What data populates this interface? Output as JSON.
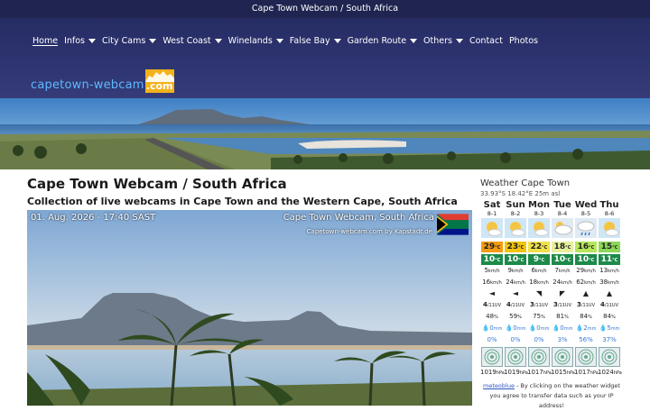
{
  "header": {
    "title": "Cape Town Webcam / South Africa"
  },
  "nav": {
    "items": [
      {
        "label": "Home",
        "dropdown": false
      },
      {
        "label": "Infos",
        "dropdown": true
      },
      {
        "label": "City Cams",
        "dropdown": true
      },
      {
        "label": "West Coast",
        "dropdown": true
      },
      {
        "label": "Winelands",
        "dropdown": true
      },
      {
        "label": "False Bay",
        "dropdown": true
      },
      {
        "label": "Garden Route",
        "dropdown": true
      },
      {
        "label": "Others",
        "dropdown": true
      },
      {
        "label": "Contact",
        "dropdown": false
      },
      {
        "label": "Photos",
        "dropdown": false
      }
    ]
  },
  "logo": {
    "text": "capetown-webcam",
    "suffix": ".com"
  },
  "main": {
    "title": "Cape Town Webcam / South Africa",
    "subtitle": "Collection of live webcams in Cape Town and the Western Cape, South Africa"
  },
  "webcam": {
    "datetime": "01. Aug. 2026 - 17:40 SAST",
    "title": "Cape Town Webcam, South Africa",
    "credit": "Capetown-webcam.com by Kapstadt.de"
  },
  "weather": {
    "title": "Weather Cape Town",
    "coords": "33.93°S 18.42°E 25m asl",
    "days": [
      {
        "name": "Sat",
        "date": "8-1",
        "icon": "sun-cloud-icon",
        "tmax": "29",
        "tmax_color": "#f39c12",
        "tmin": "10",
        "wind": "5",
        "gust": "16",
        "dir": "◄",
        "uv": "4",
        "humidity": "48",
        "rain": "0",
        "sun": "1019"
      },
      {
        "name": "Sun",
        "date": "8-2",
        "icon": "sun-cloud-icon",
        "tmax": "23",
        "tmax_color": "#f1c40f",
        "tmin": "10",
        "wind": "9",
        "gust": "24",
        "dir": "◄",
        "uv": "4",
        "humidity": "59",
        "rain": "0",
        "sun": "1019"
      },
      {
        "name": "Mon",
        "date": "8-3",
        "icon": "sun-cloud-icon",
        "tmax": "22",
        "tmax_color": "#f1e04a",
        "tmin": "9",
        "wind": "6",
        "gust": "18",
        "dir": "◥",
        "uv": "3",
        "humidity": "75",
        "rain": "0",
        "sun": "1017"
      },
      {
        "name": "Tue",
        "date": "8-4",
        "icon": "cloud-icon",
        "tmax": "18",
        "tmax_color": "#e7ef9c",
        "tmin": "10",
        "wind": "7",
        "gust": "24",
        "dir": "◤",
        "uv": "3",
        "humidity": "81",
        "rain": "0",
        "sun": "1015"
      },
      {
        "name": "Wed",
        "date": "8-5",
        "icon": "rain-cloud-icon",
        "tmax": "16",
        "tmax_color": "#b6e65a",
        "tmin": "10",
        "wind": "29",
        "gust": "62",
        "dir": "▲",
        "uv": "3",
        "humidity": "84",
        "rain": "2",
        "sun": "1017"
      },
      {
        "name": "Thu",
        "date": "8-6",
        "icon": "sun-cloud-icon",
        "tmax": "15",
        "tmax_color": "#8cd65a",
        "tmin": "11",
        "wind": "13",
        "gust": "38",
        "dir": "▲",
        "uv": "4",
        "humidity": "84",
        "rain": "5",
        "sun": "1024"
      }
    ],
    "units": {
      "temp": "°C",
      "wind": "km/h",
      "uv": "/11UV",
      "humidity": "%",
      "rain": "mm",
      "pressure": "hPa"
    },
    "rain_prob": [
      "0%",
      "0%",
      "0%",
      "3%",
      "56%",
      "37%"
    ],
    "footer_link": "meteoblue",
    "footer_text": " - By clicking on the weather widget",
    "footer_text2": "you agree to transfer data such as your IP address!"
  }
}
